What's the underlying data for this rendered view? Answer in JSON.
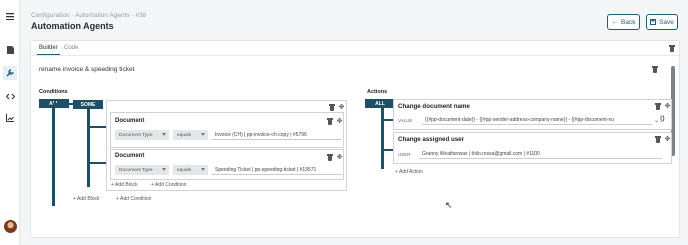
{
  "breadcrumb": "Configuration · Automation Agents · #38",
  "page_title": "Automation Agents",
  "buttons": {
    "back": "Back",
    "save": "Save"
  },
  "tabs": [
    "Builder",
    "Code"
  ],
  "agent_name": "rename invoice & speeding ticket",
  "conditions": {
    "label": "Conditions",
    "all": "ALL",
    "some": "SOME",
    "items": [
      {
        "title": "Document",
        "field": "Document Type",
        "operator": "equals",
        "value": "Invoice (CH) | pp-invoice-ch-copy | #5796"
      },
      {
        "title": "Document",
        "field": "Document Type",
        "operator": "equals",
        "value": "Speeding Ticket | pp-speeding-ticket | #19571"
      }
    ],
    "add_block": "Add Block",
    "add_condition": "Add Condition"
  },
  "actions": {
    "label": "Actions",
    "all": "ALL",
    "items": [
      {
        "title": "Change document name",
        "field_label": "VALUE",
        "value": "{{#pp-document-date}} - {{#pp-sender-address-company-name}} - {{#pp-document-nu"
      },
      {
        "title": "Change assigned user",
        "field_label": "USER",
        "value": "Granny Weatherwax | thilo.rossa@gmail.com | #1100"
      }
    ],
    "add_action": "Add Action"
  },
  "icons": [
    "menu-icon",
    "document-icon",
    "wrench-icon",
    "code-icon",
    "chart-icon",
    "arrow-left-icon",
    "save-icon",
    "trash-icon",
    "move-icon",
    "plus-icon",
    "braces-icon",
    "chevron-icon"
  ],
  "colors": {
    "accent": "#1d4f66",
    "button": "#1d5e78"
  }
}
